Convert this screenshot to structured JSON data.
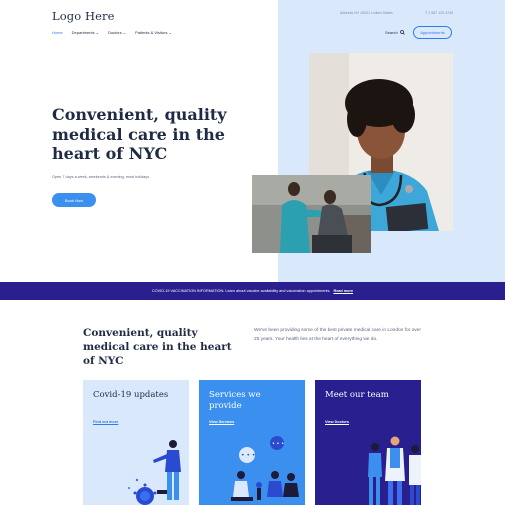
{
  "header": {
    "logo": "Logo Here",
    "address": "Address NY 10001 United States",
    "phone": "T 1 987 123 4749",
    "nav": [
      {
        "label": "Home",
        "active": true,
        "dropdown": false
      },
      {
        "label": "Departments",
        "active": false,
        "dropdown": true
      },
      {
        "label": "Doctors",
        "active": false,
        "dropdown": true
      },
      {
        "label": "Patients & Visitors",
        "active": false,
        "dropdown": true
      }
    ],
    "search_label": "Search",
    "appointment_label": "Appointments"
  },
  "hero": {
    "title": "Convenient, quality medical care in the heart of NYC",
    "subtitle": "Open 7 days a week, weekends & evening, most holidays",
    "cta_label": "Book Now"
  },
  "banner": {
    "text": "COVID-19 VACCINATION INFORMATION: Learn about vaccine availability and vaccination appointments.",
    "link": "Read more"
  },
  "intro": {
    "title": "Convenient, quality medical care in the heart of NYC",
    "text": "We've been providing some of the best private medical care in London for over 25 years. Your health lies at the heart of everything we do."
  },
  "cards": [
    {
      "title": "Covid-19 updates",
      "link": "Find out more"
    },
    {
      "title": "Services we provide",
      "link": "View Services"
    },
    {
      "title": "Meet our team",
      "link": "View Doctors"
    }
  ],
  "colors": {
    "primary": "#3b8fef",
    "dark_navy": "#1f2a44",
    "banner": "#2a1f8f",
    "light_blue": "#d9e9fb"
  }
}
